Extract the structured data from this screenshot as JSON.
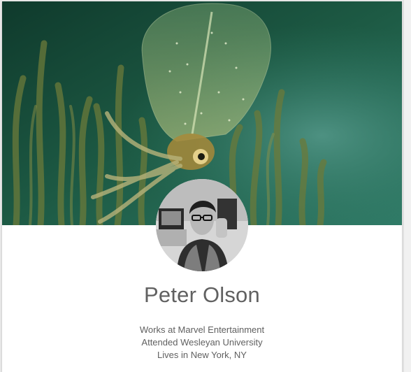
{
  "profile": {
    "name": "Peter Olson",
    "details": [
      "Works at Marvel Entertainment",
      "Attended Wesleyan University",
      "Lives in New York, NY"
    ]
  },
  "images": {
    "cover": "underwater-squid-cover-photo",
    "avatar": "profile-photo-grayscale"
  },
  "colors": {
    "name_text": "#616161",
    "detail_text": "#606060",
    "card_background": "#ffffff",
    "page_background": "#e9e9e9"
  }
}
